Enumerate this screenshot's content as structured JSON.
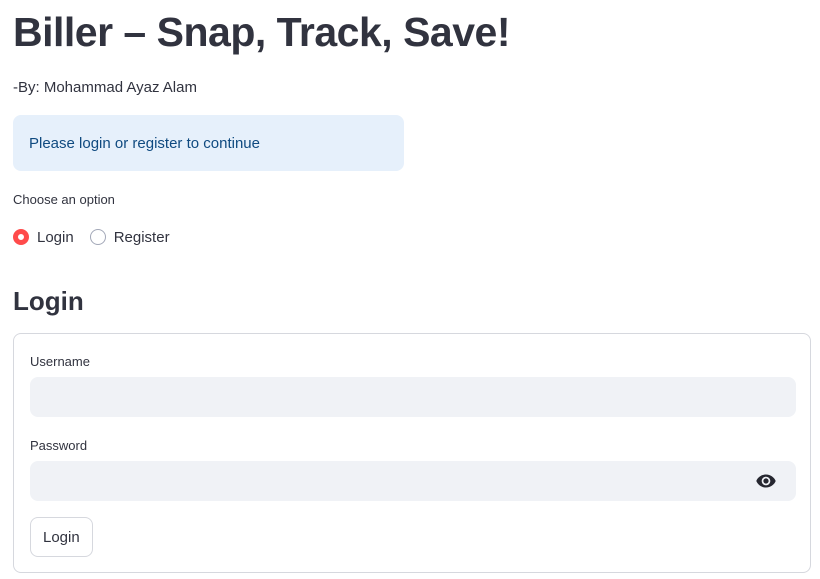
{
  "header": {
    "title": "Biller – Snap, Track, Save!",
    "byline": "-By: Mohammad Ayaz Alam"
  },
  "info": {
    "message": "Please login or register to continue"
  },
  "auth_mode": {
    "label": "Choose an option",
    "options": [
      {
        "label": "Login",
        "selected": true
      },
      {
        "label": "Register",
        "selected": false
      }
    ]
  },
  "login_form": {
    "heading": "Login",
    "username_label": "Username",
    "username_value": "",
    "password_label": "Password",
    "password_value": "",
    "submit_label": "Login",
    "password_toggle_icon": "eye-icon"
  },
  "colors": {
    "accent": "#ff4b4b",
    "info_background": "#e6f0fb",
    "info_text": "#0f4a80",
    "input_background": "#f0f2f6",
    "text": "#31333f"
  }
}
